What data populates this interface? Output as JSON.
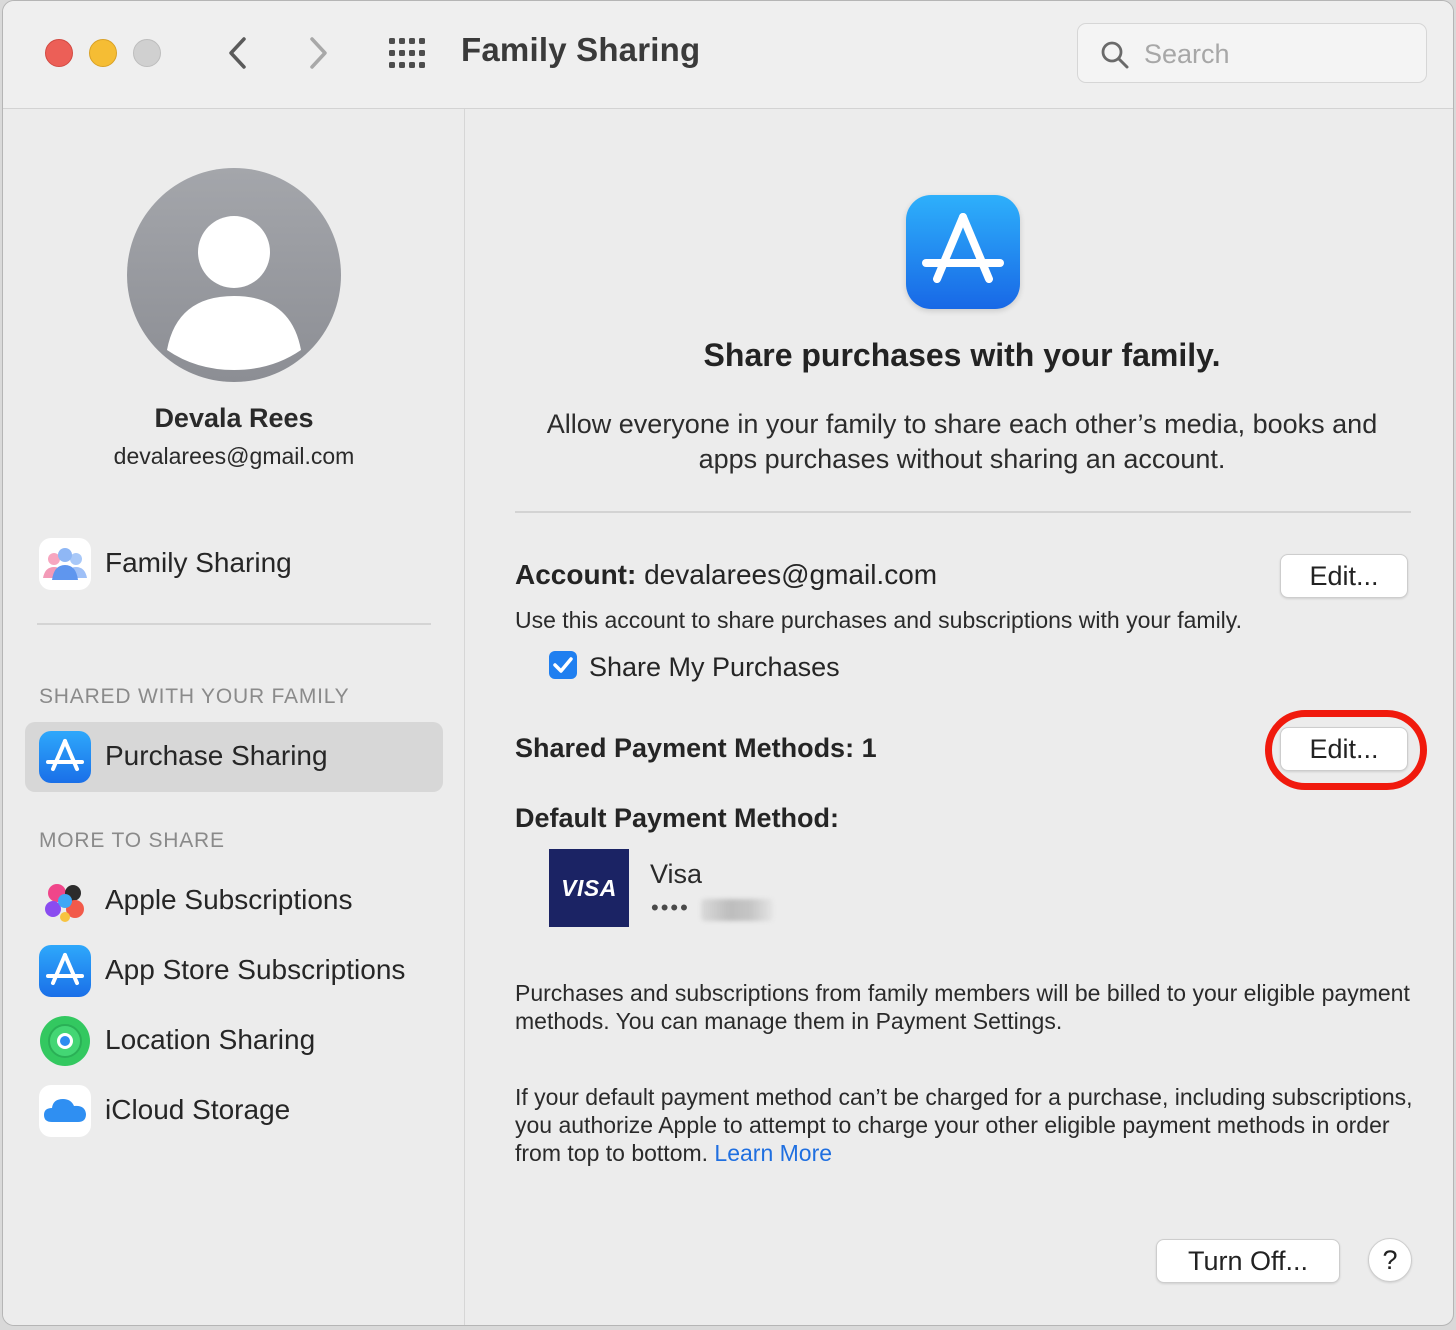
{
  "window": {
    "title": "Family Sharing",
    "search_placeholder": "Search"
  },
  "user": {
    "name": "Devala Rees",
    "email": "devalarees@gmail.com"
  },
  "sidebar": {
    "top_item": {
      "label": "Family Sharing",
      "icon": "family-sharing-icon"
    },
    "section_shared": "SHARED WITH YOUR FAMILY",
    "shared_items": [
      {
        "label": "Purchase Sharing",
        "icon": "app-store-icon",
        "selected": true
      }
    ],
    "section_more": "MORE TO SHARE",
    "more_items": [
      {
        "label": "Apple Subscriptions",
        "icon": "apple-subscriptions-icon"
      },
      {
        "label": "App Store Subscriptions",
        "icon": "app-store-icon"
      },
      {
        "label": "Location Sharing",
        "icon": "find-my-icon"
      },
      {
        "label": "iCloud Storage",
        "icon": "icloud-icon"
      }
    ]
  },
  "main": {
    "headline": "Share purchases with your family.",
    "description": "Allow everyone in your family to share each other’s media, books and apps purchases without sharing an account.",
    "account_label": "Account:",
    "account_value": "devalarees@gmail.com",
    "account_edit": "Edit...",
    "account_desc": "Use this account to share purchases and subscriptions with your family.",
    "share_my_purchases": {
      "label": "Share My Purchases",
      "checked": true
    },
    "shared_payment_methods": "Shared Payment Methods: 1",
    "payment_edit": "Edit...",
    "default_payment_label": "Default Payment Method:",
    "card": {
      "brand_logo": "VISA",
      "name": "Visa",
      "masked": "••••"
    },
    "paragraph1": "Purchases and subscriptions from family members will be billed to your eligible payment methods. You can manage them in Payment Settings.",
    "paragraph2": "If your default payment method can’t be charged for a purchase, including subscriptions, you authorize Apple to attempt to charge your other eligible payment methods in order from top to bottom.",
    "learn_more": "Learn More",
    "turn_off": "Turn Off...",
    "help": "?"
  },
  "colors": {
    "accent": "#1f7ff0",
    "highlight_ring": "#f01a0d",
    "visa_bg": "#1b2364",
    "link": "#1f6fe0"
  }
}
